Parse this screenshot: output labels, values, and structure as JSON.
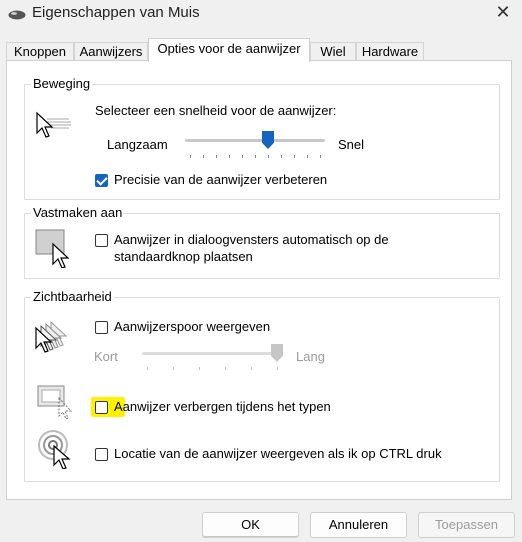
{
  "window": {
    "title": "Eigenschappen van Muis",
    "close_glyph": "✕"
  },
  "tabs": [
    {
      "label": "Knoppen",
      "active": false
    },
    {
      "label": "Aanwijzers",
      "active": false
    },
    {
      "label": "Opties voor de aanwijzer",
      "active": true
    },
    {
      "label": "Wiel",
      "active": false
    },
    {
      "label": "Hardware",
      "active": false
    }
  ],
  "motion": {
    "legend": "Beweging",
    "prompt": "Selecteer een snelheid voor de aanwijzer:",
    "slow_label": "Langzaam",
    "fast_label": "Snel",
    "speed_value": 6,
    "speed_max": 11,
    "precision_label": "Precisie van de aanwijzer verbeteren",
    "precision_checked": true
  },
  "snap": {
    "legend": "Vastmaken aan",
    "label": "Aanwijzer in dialoogvensters automatisch op de standaardknop plaatsen",
    "checked": false
  },
  "visibility": {
    "legend": "Zichtbaarheid",
    "trails_label": "Aanwijzerspoor weergeven",
    "trails_checked": false,
    "short_label": "Kort",
    "long_label": "Lang",
    "trail_value": 5,
    "trail_max": 5,
    "hide_label": "Aanwijzer verbergen tijdens het typen",
    "hide_checked": false,
    "ctrl_label": "Locatie van de aanwijzer weergeven als ik op CTRL druk",
    "ctrl_checked": false
  },
  "buttons": {
    "ok": "OK",
    "cancel": "Annuleren",
    "apply": "Toepassen"
  },
  "colors": {
    "accent": "#1565c0",
    "highlight": "#fff200"
  },
  "icons": {
    "app": "mouse-icon",
    "speed": "pointer-speed-icon",
    "snap": "snap-to-button-icon",
    "trails": "pointer-trails-icon",
    "hide": "hide-pointer-icon",
    "ctrl": "pointer-location-icon"
  }
}
